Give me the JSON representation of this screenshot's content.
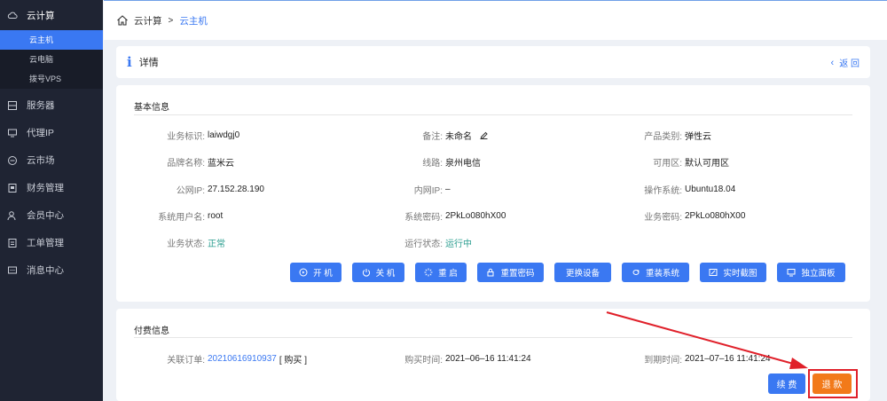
{
  "sidebar": {
    "group": {
      "label": "云计算",
      "icon": "cloud-icon"
    },
    "subitems": [
      {
        "label": "云主机",
        "active": true
      },
      {
        "label": "云电脑",
        "active": false
      },
      {
        "label": "拨号VPS",
        "active": false
      }
    ],
    "items": [
      {
        "label": "服务器",
        "icon": "server-icon"
      },
      {
        "label": "代理IP",
        "icon": "monitor-icon"
      },
      {
        "label": "云市场",
        "icon": "market-icon"
      },
      {
        "label": "财务管理",
        "icon": "finance-icon"
      },
      {
        "label": "会员中心",
        "icon": "user-icon"
      },
      {
        "label": "工单管理",
        "icon": "ticket-icon"
      },
      {
        "label": "消息中心",
        "icon": "message-icon"
      }
    ]
  },
  "breadcrumb": {
    "root": "云计算",
    "sep": ">",
    "current": "云主机"
  },
  "detail": {
    "icon": "i",
    "title": "详情",
    "back_label": "返 回"
  },
  "basic": {
    "title": "基本信息",
    "fields": {
      "business_id": {
        "label": "业务标识:",
        "value": "laiwdgj0"
      },
      "remark": {
        "label": "备注:",
        "value": "未命名"
      },
      "product_type": {
        "label": "产品类别:",
        "value": "弹性云"
      },
      "brand": {
        "label": "品牌名称:",
        "value": "蓝米云"
      },
      "line": {
        "label": "线路:",
        "value": "泉州电信"
      },
      "zone": {
        "label": "可用区:",
        "value": "默认可用区"
      },
      "public_ip": {
        "label": "公网IP:",
        "value": "27.152.28.190"
      },
      "private_ip": {
        "label": "内网IP:",
        "value": "–"
      },
      "os": {
        "label": "操作系统:",
        "value": "Ubuntu18.04"
      },
      "sys_user": {
        "label": "系统用户名:",
        "value": "root"
      },
      "sys_password": {
        "label": "系统密码:",
        "value": "2PkLo080hX00"
      },
      "biz_password": {
        "label": "业务密码:",
        "value": "2PkLo080hX00"
      },
      "biz_status": {
        "label": "业务状态:",
        "value": "正常"
      },
      "run_status": {
        "label": "运行状态:",
        "value": "运行中"
      }
    },
    "actions": {
      "power_on": "开 机",
      "power_off": "关 机",
      "restart": "重 启",
      "reset_password": "重置密码",
      "change_device": "更换设备",
      "reinstall": "重装系统",
      "screenshot": "实时截图",
      "panel": "独立面板"
    }
  },
  "pay": {
    "title": "付费信息",
    "order": {
      "label": "关联订单:",
      "value": "20210616910937",
      "suffix": "[ 购买 ]"
    },
    "buy_time": {
      "label": "购买时间:",
      "value": "2021–06–16 11:41:24"
    },
    "expire_time": {
      "label": "到期时间:",
      "value": "2021–07–16 11:41:24"
    },
    "renew_label": "续 费",
    "refund_label": "退 款"
  },
  "colors": {
    "accent": "#3a78f2",
    "sidebar": "#1f2433",
    "refund": "#f27a1a",
    "highlight": "#e0202a"
  }
}
